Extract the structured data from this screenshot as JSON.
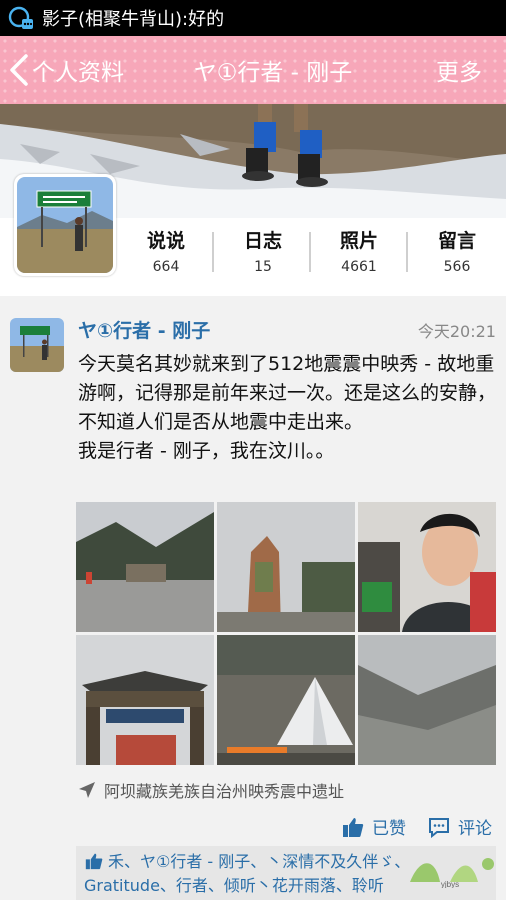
{
  "status_bar": {
    "notification": "影子(相聚牛背山):好的"
  },
  "title_bar": {
    "back_label": "个人资料",
    "title": "ヤ①行者 - 刚子",
    "more_label": "更多"
  },
  "stats": [
    {
      "label": "说说",
      "count": "664"
    },
    {
      "label": "日志",
      "count": "15"
    },
    {
      "label": "照片",
      "count": "4661"
    },
    {
      "label": "留言",
      "count": "566"
    }
  ],
  "post": {
    "author": "ヤ①行者 - 刚子",
    "time": "今天20:21",
    "text": "今天莫名其妙就来到了512地震震中映秀 - 故地重游啊，记得那是前年来过一次。还是这么的安静，不知道人们是否从地震中走出来。\n我是行者 - 刚子，我在汶川。。",
    "location": "阿坝藏族羌族自治州映秀震中遗址",
    "like_label": "已赞",
    "comment_label": "评论",
    "likers": "禾、ヤ①行者 - 刚子、丶深情不及久伴ゞ、Gratitude、行者、倾听丶花开雨落、聆听"
  },
  "watermark": "yjbys",
  "colors": {
    "title_bar": "#f7a7b9",
    "link": "#2a6ea8"
  }
}
